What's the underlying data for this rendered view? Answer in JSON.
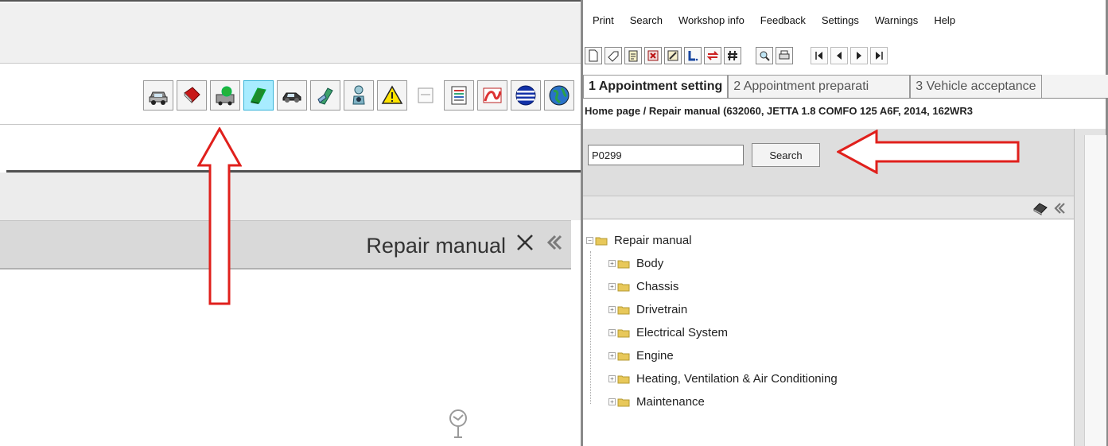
{
  "left_panel": {
    "repair_manual_title": "Repair manual",
    "toolbar_icons": [
      "car-icon",
      "book-icon",
      "vehicle-diagnostic-icon",
      "repair-manual-icon",
      "vehicle-side-icon",
      "tools-icon",
      "technician-icon",
      "warning-icon",
      "checkbox-icon",
      "list-icon",
      "chart-icon",
      "network-icon",
      "globe-icon"
    ],
    "active_icon": "repair-manual-icon"
  },
  "menu": [
    "Print",
    "Search",
    "Workshop info",
    "Feedback",
    "Settings",
    "Warnings",
    "Help"
  ],
  "tabs": [
    {
      "label": "1 Appointment setting",
      "active": true
    },
    {
      "label": "2 Appointment preparati",
      "active": false
    },
    {
      "label": "3 Vehicle acceptance",
      "active": false
    }
  ],
  "breadcrumb": "Home page / Repair manual (632060, JETTA 1.8 COMFO 125 A6F, 2014, 162WR3",
  "search": {
    "value": "P0299",
    "button_label": "Search"
  },
  "tree": {
    "root": "Repair manual",
    "children": [
      "Body",
      "Chassis",
      "Drivetrain",
      "Electrical System",
      "Engine",
      "Heating, Ventilation & Air Conditioning",
      "Maintenance"
    ]
  },
  "colors": {
    "annotation_arrow": "#e0201c",
    "active_icon_bg": "#a8ecff",
    "folder": "#e8c85a"
  }
}
